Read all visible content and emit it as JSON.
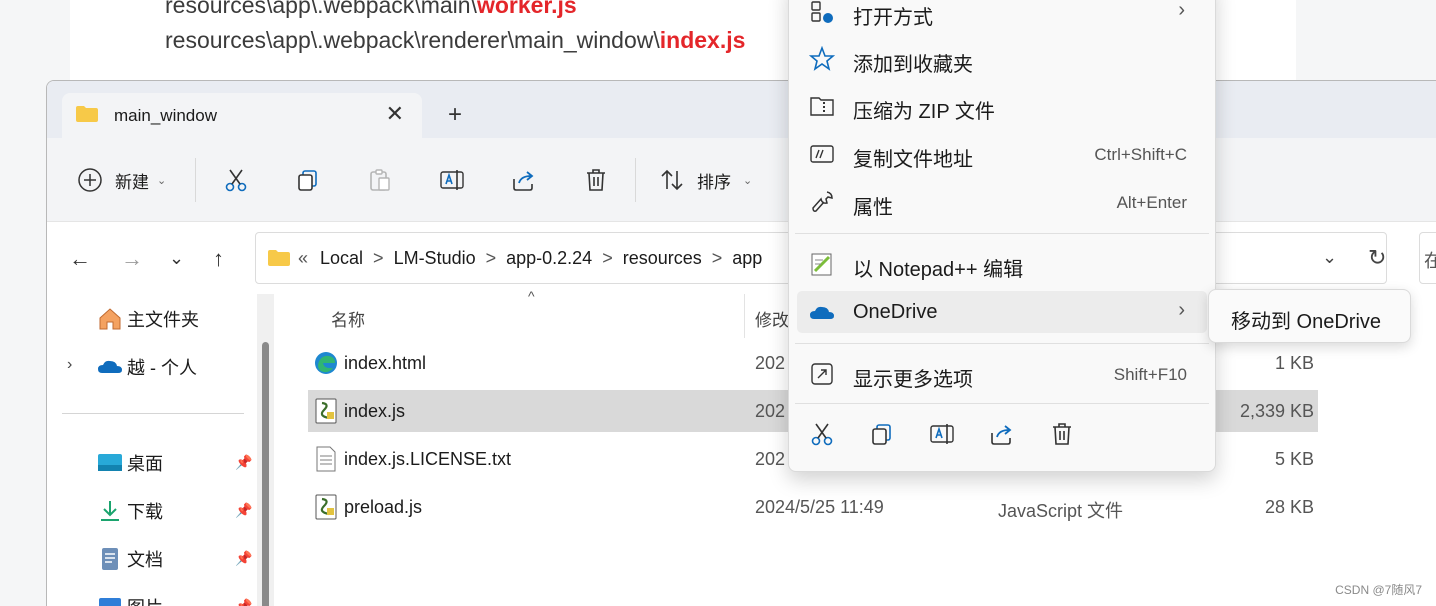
{
  "article": {
    "line1_prefix": "resources\\app\\.webpack\\main\\",
    "line1_file": "worker.js",
    "line2_prefix": "resources\\app\\.webpack\\renderer\\main_window\\",
    "line2_file": "index.js"
  },
  "window": {
    "tab_title": "main_window",
    "close_glyph": "✕",
    "newtab_glyph": "+"
  },
  "toolbar": {
    "new_label": "新建",
    "sort_label": "排序",
    "caret": "⌄"
  },
  "address": {
    "back": "←",
    "forward": "→",
    "recent": "⌄",
    "up": "↑",
    "overflow": "«",
    "crumbs": [
      "Local",
      "LM-Studio",
      "app-0.2.24",
      "resources",
      "app"
    ],
    "separator": ">",
    "dropdown": "⌄",
    "refresh": "↻",
    "search_partial": "在"
  },
  "sidebar": {
    "home": "主文件夹",
    "onedrive": "越 - 个人",
    "desktop": "桌面",
    "downloads": "下载",
    "documents": "文档",
    "pictures": "图片",
    "pin": "📌",
    "expand": "›"
  },
  "filelist": {
    "col_name": "名称",
    "col_modified": "修改",
    "sort_caret": "^",
    "rows": [
      {
        "name": "index.html",
        "date": "202",
        "type": "",
        "size": "1 KB",
        "icon": "edge-html-icon"
      },
      {
        "name": "index.js",
        "date": "202",
        "type": "",
        "size": "2,339 KB",
        "icon": "js-file-icon"
      },
      {
        "name": "index.js.LICENSE.txt",
        "date": "202",
        "type": "",
        "size": "5 KB",
        "icon": "text-file-icon"
      },
      {
        "name": "preload.js",
        "date": "2024/5/25 11:49",
        "type": "JavaScript 文件",
        "size": "28 KB",
        "icon": "js-file-icon"
      }
    ]
  },
  "context_menu": {
    "open_with": "打开方式",
    "add_favorites": "添加到收藏夹",
    "compress_zip": "压缩为 ZIP 文件",
    "copy_path": "复制文件地址",
    "copy_path_shortcut": "Ctrl+Shift+C",
    "properties": "属性",
    "properties_shortcut": "Alt+Enter",
    "notepadpp": "以 Notepad++ 编辑",
    "onedrive": "OneDrive",
    "more_options": "显示更多选项",
    "more_options_shortcut": "Shift+F10",
    "submenu_arrow": "›"
  },
  "submenu": {
    "move_to_onedrive": "移动到 OneDrive"
  },
  "watermark": "CSDN @7随风7",
  "colors": {
    "accent_blue": "#0f6cbd",
    "highlight_red": "#e4262a",
    "folder_yellow": "#f7c948"
  }
}
